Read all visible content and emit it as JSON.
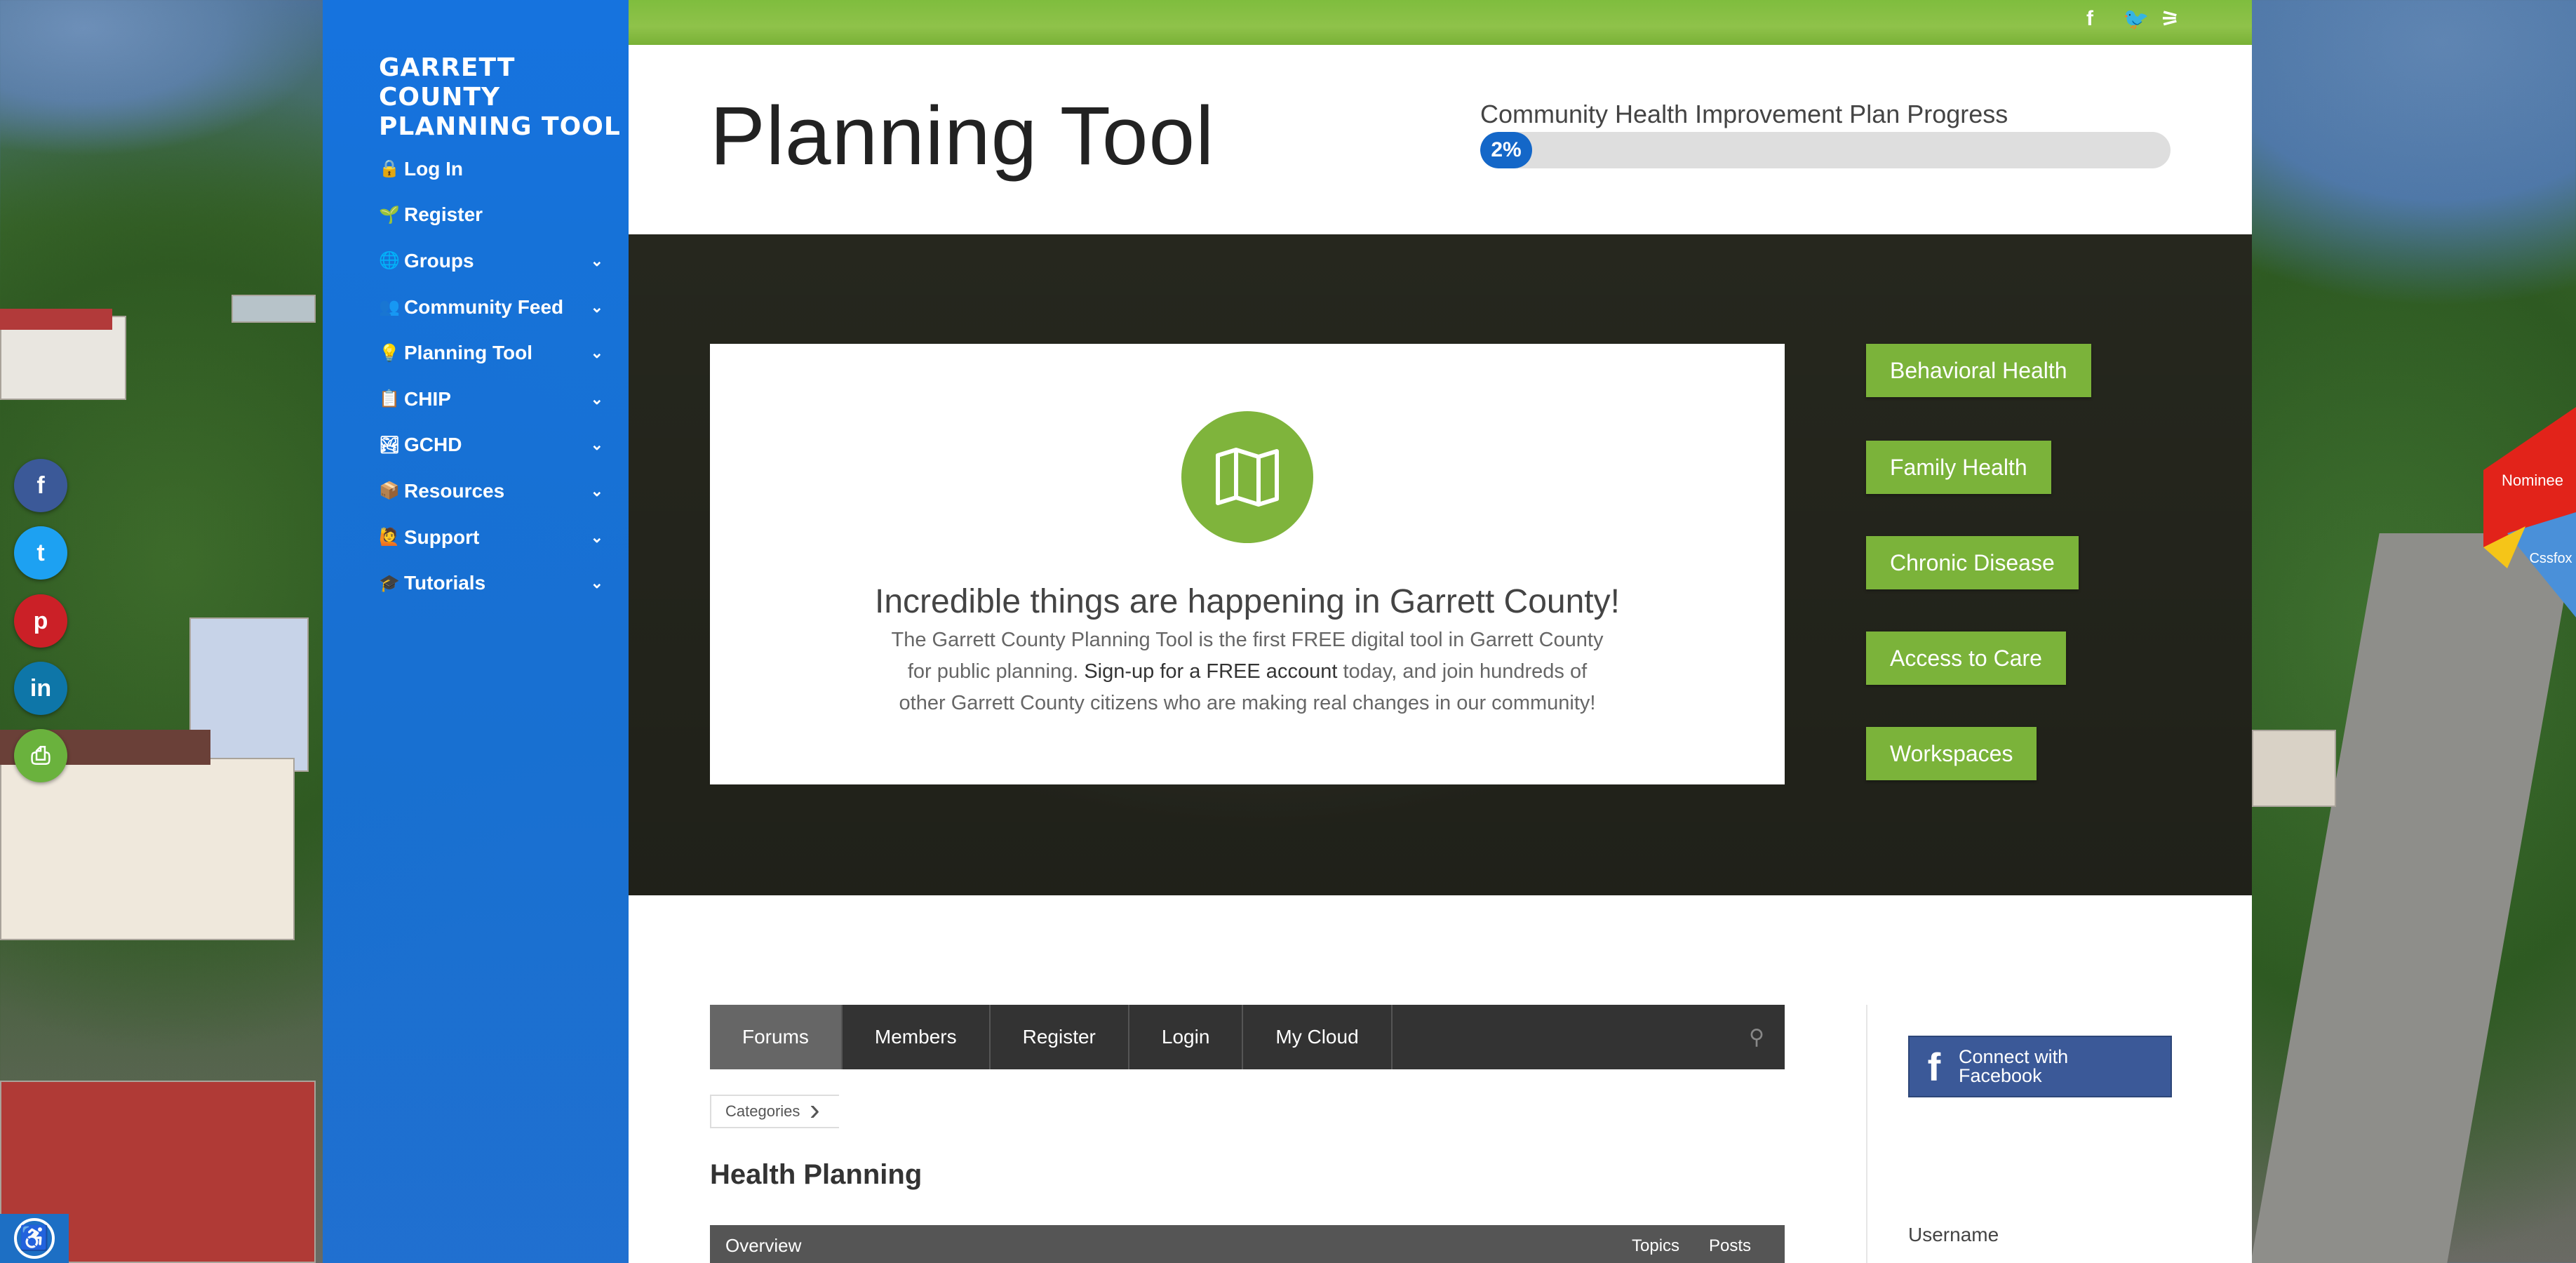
{
  "colors": {
    "sidebar_blue": "#1473e1",
    "accent_green": "#7bb33a",
    "progress_blue": "#1467c8",
    "forum_bar": "#333333",
    "facebook": "#3b5998"
  },
  "share_bar": {
    "items": [
      {
        "icon": "facebook-icon",
        "glyph": "f",
        "color": "#3b5998"
      },
      {
        "icon": "twitter-icon",
        "glyph": "t",
        "color": "#1da1f2"
      },
      {
        "icon": "pinterest-icon",
        "glyph": "p",
        "color": "#cb2027"
      },
      {
        "icon": "linkedin-icon",
        "glyph": "in",
        "color": "#0e76a8"
      },
      {
        "icon": "print-icon",
        "glyph": "⎙",
        "color": "#6ab23d"
      }
    ]
  },
  "accessibility": {
    "icon": "accessibility-icon",
    "glyph": "♿"
  },
  "sidebar": {
    "logo": "GARRETT COUNTY PLANNING TOOL",
    "logo_line1": "GARRETT COUNTY",
    "logo_line2": "PLANNING TOOL",
    "items": [
      {
        "label": "Log In",
        "icon": "lock-icon",
        "glyph": "🔒",
        "submenu": false
      },
      {
        "label": "Register",
        "icon": "sprout-icon",
        "glyph": "🌱",
        "submenu": false
      },
      {
        "label": "Groups",
        "icon": "globe-icon",
        "glyph": "🌐",
        "submenu": true
      },
      {
        "label": "Community Feed",
        "icon": "people-icon",
        "glyph": "👥",
        "submenu": true
      },
      {
        "label": "Planning Tool",
        "icon": "lightbulb-icon",
        "glyph": "💡",
        "submenu": true
      },
      {
        "label": "CHIP",
        "icon": "chip-icon",
        "glyph": "📋",
        "submenu": true
      },
      {
        "label": "GCHD",
        "icon": "landscape-icon",
        "glyph": "🏞",
        "submenu": true
      },
      {
        "label": "Resources",
        "icon": "box-icon",
        "glyph": "📦",
        "submenu": true
      },
      {
        "label": "Support",
        "icon": "support-icon",
        "glyph": "🙋",
        "submenu": true
      },
      {
        "label": "Tutorials",
        "icon": "tutorial-icon",
        "glyph": "🎓",
        "submenu": true
      }
    ],
    "chevron": "⌄"
  },
  "top_social": [
    {
      "icon": "facebook-icon",
      "glyph": "f"
    },
    {
      "icon": "twitter-icon",
      "glyph": "🐦"
    },
    {
      "icon": "rss-icon",
      "glyph": "⚞"
    }
  ],
  "header": {
    "title": "Planning Tool",
    "progress_label": "Community Health Improvement Plan Progress",
    "progress_value": "2%",
    "progress_fraction": 0.02
  },
  "hero": {
    "icon": "map-icon",
    "heading": "Incredible things are happening in Garrett County!",
    "text_before": "The Garrett County Planning Tool is the first FREE digital tool in Garrett County for public planning. ",
    "text_link": "Sign-up for a FREE account",
    "text_after": " today, and join hundreds of other Garrett County citizens who are making real changes in our community!",
    "buttons": [
      "Behavioral Health",
      "Family Health",
      "Chronic Disease",
      "Access to Care",
      "Workspaces"
    ]
  },
  "forum": {
    "tabs": [
      "Forums",
      "Members",
      "Register",
      "Login",
      "My Cloud"
    ],
    "active_tab": 0,
    "search_icon": "search-icon",
    "breadcrumb": "Categories",
    "section_title": "Health Planning",
    "overview": {
      "label": "Overview",
      "topics": "Topics",
      "posts": "Posts"
    }
  },
  "right_panel": {
    "facebook_button": "Connect with Facebook",
    "facebook_line1": "Connect with",
    "facebook_line2": "Facebook",
    "username_label": "Username"
  },
  "badge": {
    "nominee": "Nominee",
    "cssfox": "Cssfox"
  }
}
